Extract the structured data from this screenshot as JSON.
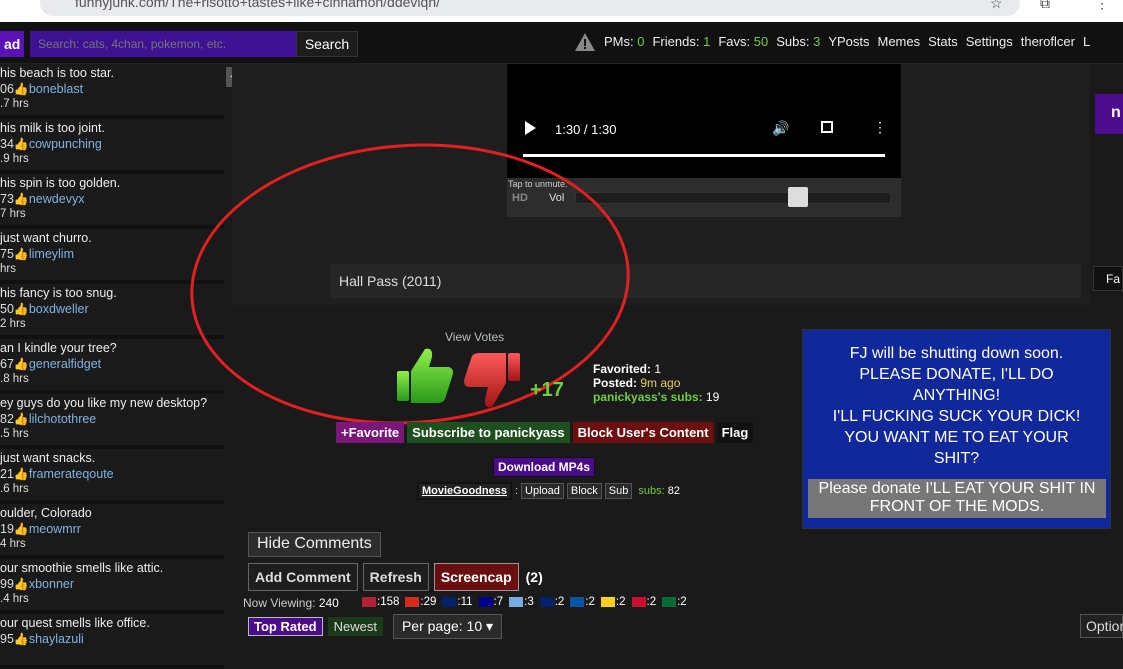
{
  "browser": {
    "url": "funnyjunk.com/The+risotto+tastes+like+cinnamon/ddevlqh/"
  },
  "topbar": {
    "load_label": "ad",
    "search_placeholder": "Search: cats, 4chan, pokemon, etc.",
    "search_button": "Search",
    "pms_label": "PMs:",
    "pms_count": "0",
    "friends_label": "Friends:",
    "friends_count": "1",
    "favs_label": "Favs:",
    "favs_count": "50",
    "subs_label": "Subs:",
    "subs_count": "3",
    "yposts": "YPosts",
    "memes": "Memes",
    "stats": "Stats",
    "settings": "Settings",
    "username": "theroflcer",
    "trailing": "L"
  },
  "sidebar": {
    "items": [
      {
        "title": "his beach is too star.",
        "score": "06",
        "user": "boneblast",
        "time": ".7 hrs"
      },
      {
        "title": "his milk is too joint.",
        "score": "34",
        "user": "cowpunching",
        "time": ".9 hrs"
      },
      {
        "title": "his spin is too golden.",
        "score": "73",
        "user": "newdevyx",
        "time": "7 hrs"
      },
      {
        "title": "just want churro.",
        "score": "75",
        "user": "limeylim",
        "time": "hrs"
      },
      {
        "title": "his fancy is too snug.",
        "score": "50",
        "user": "boxdweller",
        "time": "2 hrs"
      },
      {
        "title": "an I kindle your tree?",
        "score": "67",
        "user": "generalfidget",
        "time": ".8 hrs"
      },
      {
        "title": "ey guys do you like my new desktop?",
        "score": "82",
        "user": "lilchotothree",
        "time": ".5 hrs"
      },
      {
        "title": "just want snacks.",
        "score": "21",
        "user": "framerateqoute",
        "time": ".6 hrs"
      },
      {
        "title": "oulder, Colorado",
        "score": "19",
        "user": "meowmrr",
        "time": "4 hrs"
      },
      {
        "title": "our smoothie smells like attic.",
        "score": "99",
        "user": "xbonner",
        "time": ".4 hrs"
      },
      {
        "title": "our quest smells like office.",
        "score": "95",
        "user": "shaylazuli",
        "time": ""
      }
    ]
  },
  "player": {
    "time": "1:30 / 1:30",
    "tap_text": "Tap to unmute.",
    "hd": "HD",
    "vol": "Vol"
  },
  "caption": "Hall Pass (2011)",
  "right_stub_1": "n",
  "right_stub_2": "Fa",
  "votes": {
    "view_votes": "View Votes",
    "score": "+17",
    "favorited_label": "Favorited:",
    "favorited": "1",
    "posted_label": "Posted:",
    "posted": "9m ago",
    "subs_label": "panickyass's subs:",
    "subs": "19"
  },
  "actions": {
    "favorite": "+Favorite",
    "subscribe": "Subscribe to panickyass",
    "block": "Block User's Content",
    "flag": "Flag",
    "download": "Download MP4s"
  },
  "channel": {
    "name": "MovieGoodness",
    "sep": ":",
    "upload": "Upload",
    "block": "Block",
    "sub": "Sub",
    "subs_label": "subs:",
    "subs": "82"
  },
  "ad": {
    "lines": [
      "FJ will be shutting down soon.",
      "PLEASE DONATE, I'LL DO",
      "ANYTHING!",
      "I'LL FUCKING SUCK YOUR DICK!",
      "YOU WANT ME TO EAT YOUR",
      "SHIT?"
    ],
    "donate": "Please donate I'LL EAT YOUR SHIT IN FRONT OF THE MODS."
  },
  "comments": {
    "hide": "Hide Comments",
    "add": "Add Comment",
    "refresh": "Refresh",
    "screencap": "Screencap",
    "count": "(2)",
    "now_viewing_label": "Now Viewing:",
    "now_viewing": "240",
    "flags": [
      {
        "count": ":158",
        "color": "#b22234"
      },
      {
        "count": ":29",
        "color": "#d52b1e"
      },
      {
        "count": ":11",
        "color": "#012169"
      },
      {
        "count": ":7",
        "color": "#00008b"
      },
      {
        "count": ":3",
        "color": "#74acdf"
      },
      {
        "count": ":2",
        "color": "#012169"
      },
      {
        "count": ":2",
        "color": "#0055a4"
      },
      {
        "count": ":2",
        "color": "#fcd116"
      },
      {
        "count": ":2",
        "color": "#c8102e"
      },
      {
        "count": ":2",
        "color": "#046a38"
      }
    ],
    "top_rated": "Top Rated",
    "newest": "Newest",
    "per_page": "Per page: 10 ▾",
    "options": "Option"
  }
}
